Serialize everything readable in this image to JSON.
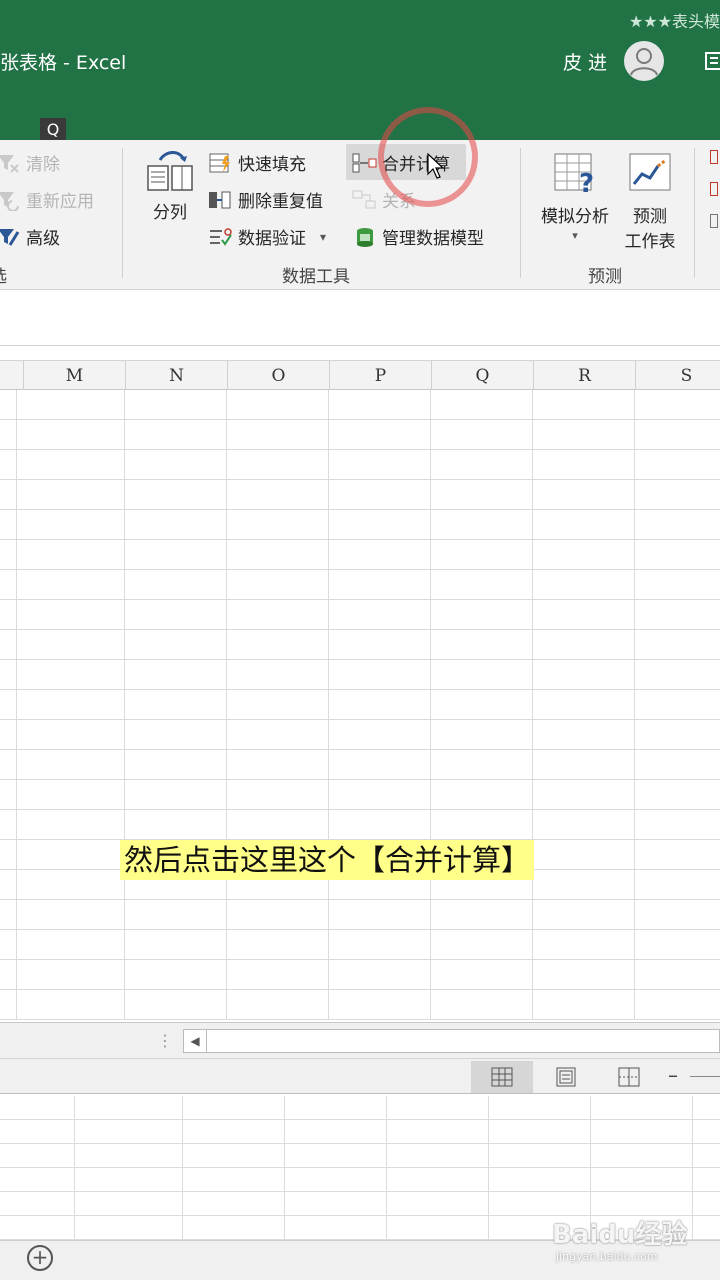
{
  "titlebar": {
    "top_strip": "★★★表头模",
    "doc_title": "张表格  -  Excel",
    "user_name": "皮 进",
    "tell_me_icon": "Q"
  },
  "ribbon": {
    "filter_group": {
      "clear": "清除",
      "reapply": "重新应用",
      "advanced": "高级",
      "label": "选"
    },
    "data_tools": {
      "split_column": "分列",
      "flash_fill": "快速填充",
      "remove_duplicates": "删除重复值",
      "data_validation": "数据验证",
      "consolidate": "合并计算",
      "relationships": "关系",
      "manage_data_model": "管理数据模型",
      "label": "数据工具"
    },
    "forecast": {
      "what_if": "模拟分析",
      "forecast_sheet_line1": "预测",
      "forecast_sheet_line2": "工作表",
      "label": "预测"
    }
  },
  "columns": [
    "M",
    "N",
    "O",
    "P",
    "Q",
    "R",
    "S"
  ],
  "caption": "然后点击这里这个【合并计算】",
  "status": {
    "add_sheet": "+"
  },
  "watermark": {
    "main": "Baidu经验",
    "sub": "jingyan.baidu.com"
  },
  "colors": {
    "excel_green": "#217346",
    "ribbon_bg": "#f2f2f2",
    "highlight": "#ffff8a",
    "red_circle": "#e64646"
  }
}
